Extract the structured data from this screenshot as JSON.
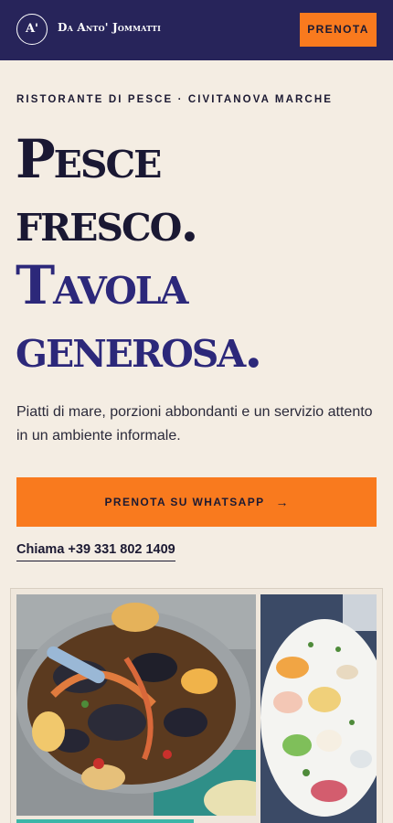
{
  "header": {
    "logo_text": "A'",
    "brand_name": "Da Anto' Jommatti",
    "book_button": "PRENOTA"
  },
  "hero": {
    "eyebrow": "RISTORANTE DI PESCE · CIVITANOVA MARCHE",
    "headline_line1": "Pesce",
    "headline_line2": "fresco.",
    "headline_line3": "Tavola",
    "headline_line4": "generosa.",
    "description": "Piatti di mare, porzioni abbondanti e un servizio attento in un ambiente informale.",
    "whatsapp_button": "PRENOTA SU WHATSAPP",
    "whatsapp_arrow": "→",
    "call_link": "Chiama +39 331 802 1409"
  },
  "icons": {
    "logo": "monogram-circle-icon",
    "cta_arrow": "arrow-right-icon"
  },
  "colors": {
    "header_bg": "#27245a",
    "accent_orange": "#f97a1e",
    "page_bg": "#f4ede3",
    "headline_dark": "#1a1833",
    "headline_blue": "#2c287a",
    "teal": "#3bb6a8"
  }
}
